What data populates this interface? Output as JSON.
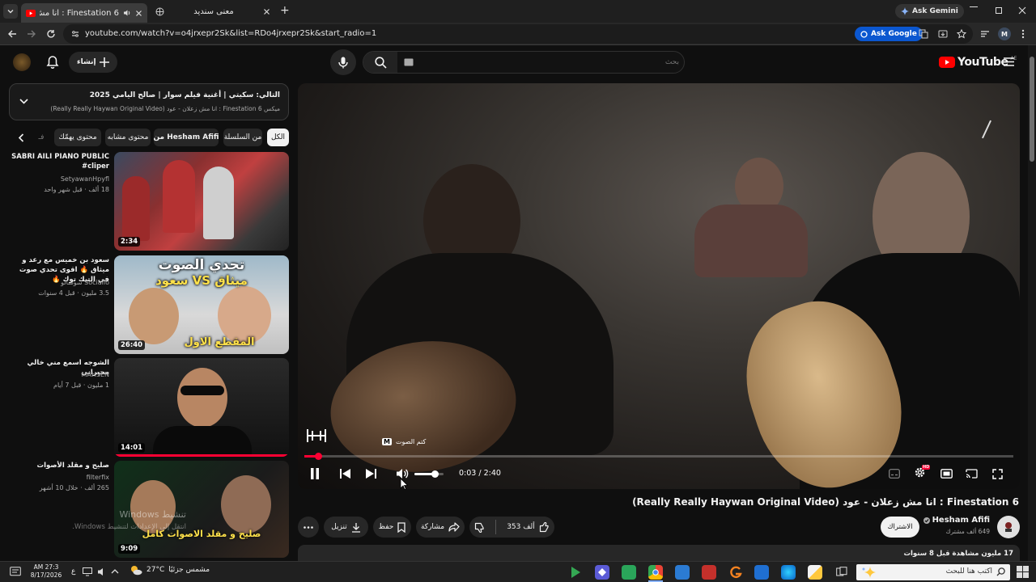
{
  "browser": {
    "tabs": [
      {
        "title": "Finestation 6 : انا مش زعلان - عود",
        "active": true
      },
      {
        "title": "معنى سنديد",
        "active": false
      }
    ],
    "new_tab": "+",
    "ask_gemini": "Ask Gemini",
    "url": "youtube.com/watch?v=o4jrxepr2Sk&list=RDo4jrxepr2Sk&start_radio=1",
    "ask_google": "Ask Google",
    "profile_initial": "M"
  },
  "youtube": {
    "logo": "YouTube",
    "region": "AE",
    "create_label": "إنشاء",
    "search_placeholder": "بحث"
  },
  "playlist": {
    "next_label": "التالي: سكيتي | أغنية فيلم سوار | صالح اليامي 2025",
    "subtitle": "ميكس Finestation 6 : انا مش زعلان - عود (Really Really Haywan Original Video)"
  },
  "chips": [
    "الكل",
    "من السلسلة",
    "من Hesham Afifi",
    "محتوى مشابه",
    "محتوى يهمّك",
    "فـ"
  ],
  "recommendations": [
    {
      "title": "SABRI AILI PIANO PUBLIC #cliper",
      "channel": "SetyawanHpyfl",
      "views": "18 ألف",
      "age": "قبل شهر واحد",
      "duration": "2:34"
    },
    {
      "title": "سعود بن خميس مع رعد و ميثاق 🔥 اقوى تحدي صوت في التيك توك 🔥",
      "channel": "سوشالو Sociallo",
      "views": "3.5 مليون",
      "age": "قبل 4 سنوات",
      "duration": "26:40",
      "thumb_text_1": "تحدي الصوت",
      "thumb_text_2": "ميثاق VS سعود",
      "thumb_text_3": "المقطع الاول"
    },
    {
      "title": "الشوجه اسمع مني خالي محيراني",
      "channel": "MAHSEN",
      "views": "1 مليون",
      "age": "قبل 7 أيام",
      "duration": "14:01"
    },
    {
      "title": "صليح و مقلد الأصوات",
      "channel": "filterfix",
      "views": "265 ألف",
      "age": "خلال 10 أشهر",
      "duration": "9:09",
      "thumb_text": "صليح و مقلد الاصوات كامل"
    }
  ],
  "windows_watermark": {
    "line1": "تنشيط Windows",
    "line2": "انتقل إلى الإعدادات لتنشيط Windows."
  },
  "player": {
    "time_current": "0:03",
    "time_total": "2:40",
    "progress_fraction": 0.019,
    "volume_fraction": 0.7,
    "mute_tooltip": "كتم الصوت",
    "mute_key": "M",
    "hd_badge": "HD"
  },
  "video": {
    "title": "Finestation 6 : انا مش زعلان - عود (Really Really Haywan Original Video)",
    "channel": "Hesham Afifi",
    "subscribers": "649 ألف مشترك",
    "subscribe_label": "الاشتراك",
    "likes": "353 ألف",
    "share_label": "مشاركة",
    "save_label": "حفظ",
    "download_label": "تنزيل",
    "views": "17 مليون مشاهدة",
    "age": "قبل 8 سنوات"
  },
  "taskbar": {
    "time": "AM 27:3",
    "date": "8/17/2026",
    "lang": "ع",
    "weather_temp": "27°C",
    "weather_desc": "مشمس جزئيًا",
    "search_placeholder": "اكتب هنا للبحث"
  },
  "colors": {
    "youtube_red": "#ff0000",
    "gemini_blue": "#8ab4f8",
    "ask_google_bg": "#0b57d0"
  }
}
